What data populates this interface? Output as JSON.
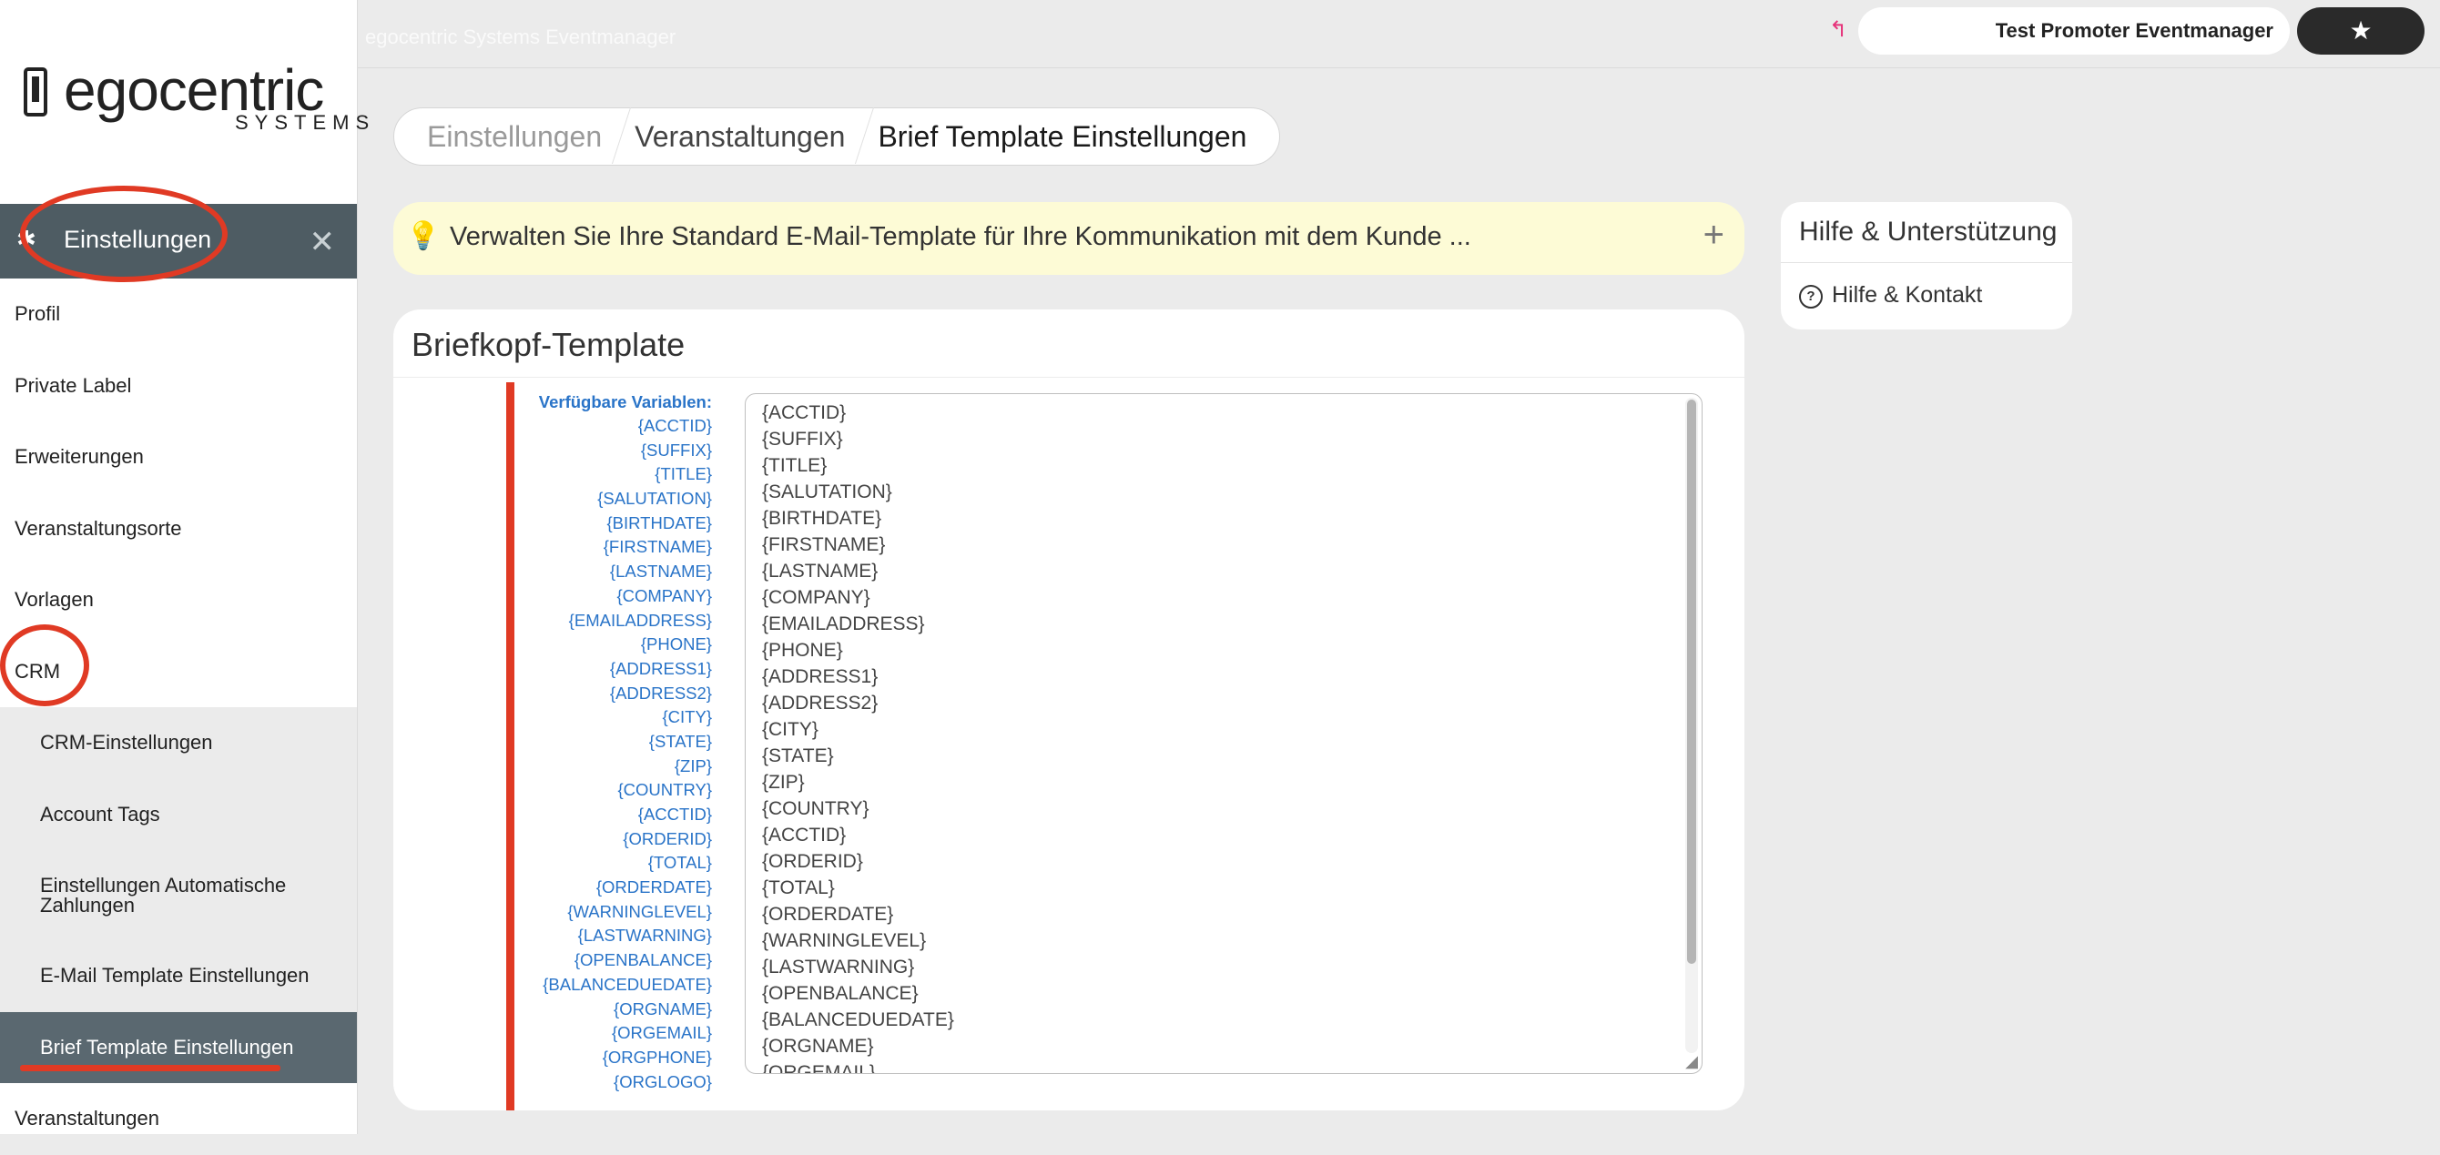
{
  "app": {
    "title": "egocentric Systems Eventmanager",
    "user": "Test Promoter Eventmanager",
    "logo_word": "egocentric",
    "logo_sub": "SYSTEMS"
  },
  "sidebar": {
    "section_title": "Einstellungen",
    "items": [
      {
        "label": "Profil"
      },
      {
        "label": "Private Label"
      },
      {
        "label": "Erweiterungen"
      },
      {
        "label": "Veranstaltungsorte"
      },
      {
        "label": "Vorlagen"
      },
      {
        "label": "CRM"
      }
    ],
    "crm_sub": [
      {
        "label": "CRM-Einstellungen"
      },
      {
        "label": "Account Tags"
      },
      {
        "label": "Einstellungen Automatische Zahlungen"
      },
      {
        "label": "E-Mail Template Einstellungen"
      },
      {
        "label": "Brief Template Einstellungen"
      }
    ],
    "after": [
      {
        "label": "Veranstaltungen"
      }
    ]
  },
  "breadcrumb": [
    "Einstellungen",
    "Veranstaltungen",
    "Brief Template Einstellungen"
  ],
  "banner": {
    "text": "Verwalten Sie Ihre Standard E-Mail-Template für Ihre Kommunikation mit dem Kunde ..."
  },
  "help": {
    "title": "Hilfe & Unterstützung",
    "link": "Hilfe & Kontakt"
  },
  "card": {
    "title": "Briefkopf-Template",
    "vars_label": "Verfügbare Variablen:",
    "variables": [
      "{ACCTID}",
      "{SUFFIX}",
      "{TITLE}",
      "{SALUTATION}",
      "{BIRTHDATE}",
      "{FIRSTNAME}",
      "{LASTNAME}",
      "{COMPANY}",
      "{EMAILADDRESS}",
      "{PHONE}",
      "{ADDRESS1}",
      "{ADDRESS2}",
      "{CITY}",
      "{STATE}",
      "{ZIP}",
      "{COUNTRY}",
      "{ACCTID}",
      "{ORDERID}",
      "{TOTAL}",
      "{ORDERDATE}",
      "{WARNINGLEVEL}",
      "{LASTWARNING}",
      "{OPENBALANCE}",
      "{BALANCEDUEDATE}",
      "{ORGNAME}",
      "{ORGEMAIL}",
      "{ORGPHONE}",
      "{ORGLOGO}"
    ],
    "editor_lines": [
      "{ACCTID}",
      "{SUFFIX}",
      "{TITLE}",
      "{SALUTATION}",
      "{BIRTHDATE}",
      "{FIRSTNAME}",
      "{LASTNAME}",
      "{COMPANY}",
      "{EMAILADDRESS}",
      "{PHONE}",
      "{ADDRESS1}",
      "{ADDRESS2}",
      "{CITY}",
      "{STATE}",
      "{ZIP}",
      "{COUNTRY}",
      "{ACCTID}",
      "{ORDERID}",
      "{TOTAL}",
      "{ORDERDATE}",
      "{WARNINGLEVEL}",
      "{LASTWARNING}",
      "{OPENBALANCE}",
      "{BALANCEDUEDATE}",
      "{ORGNAME}",
      "{ORGEMAIL}"
    ]
  },
  "colors": {
    "accent_red": "#e03a24",
    "link_blue": "#2a74c8",
    "sidebar_head": "#4e5c63",
    "banner_bg": "#fdfbd6"
  },
  "icons": {
    "gear": "gear-icon",
    "close": "close-icon",
    "bulb": "lightbulb-icon",
    "plus": "plus-icon",
    "help": "question-circle-icon",
    "back": "back-arrow-icon",
    "star": "star-icon"
  }
}
